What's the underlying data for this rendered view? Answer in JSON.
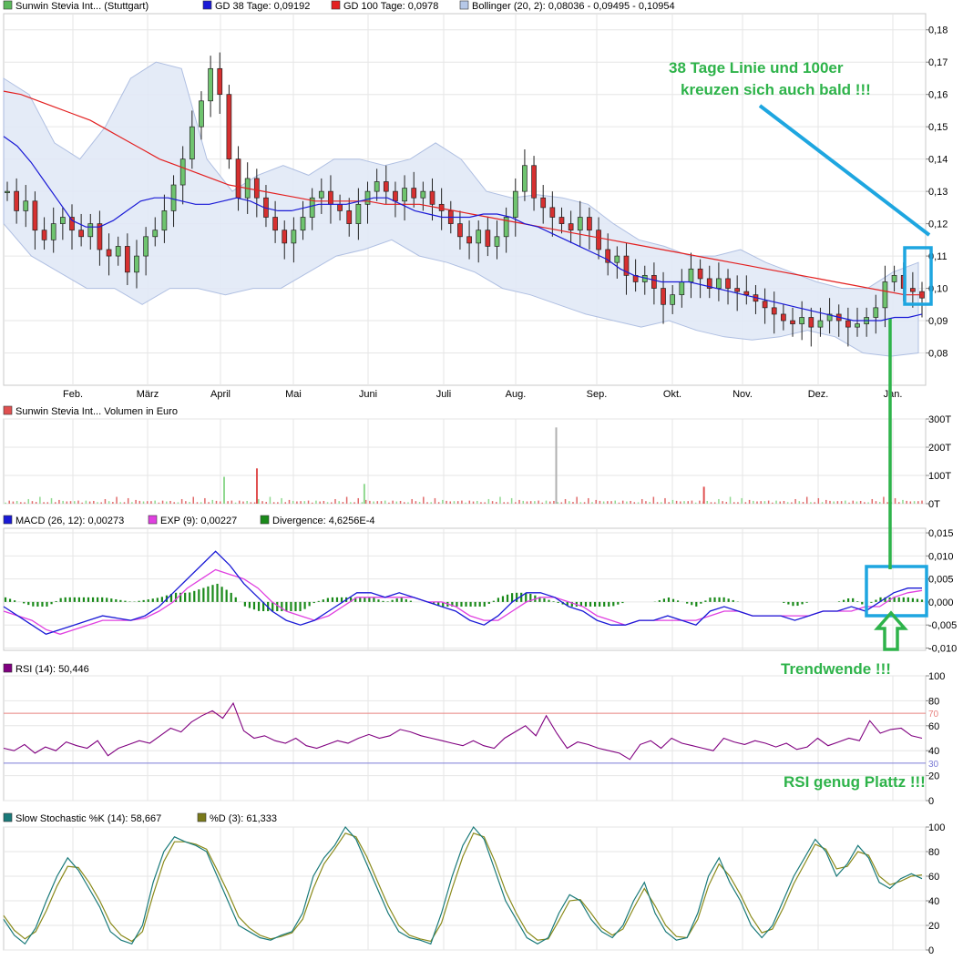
{
  "chart_data": [
    {
      "type": "candlestick",
      "panel": "price",
      "x_month_labels": [
        "Feb.",
        "März",
        "April",
        "Mai",
        "Juni",
        "Juli",
        "Aug.",
        "Sep.",
        "Okt.",
        "Nov.",
        "Dez.",
        "Jan."
      ],
      "ylim": [
        0.07,
        0.185
      ],
      "yticks": [
        "0,08",
        "0,09",
        "0,10",
        "0,11",
        "0,12",
        "0,13",
        "0,14",
        "0,15",
        "0,16",
        "0,17",
        "0,18"
      ],
      "ytick_values": [
        0.08,
        0.09,
        0.1,
        0.11,
        0.12,
        0.13,
        0.14,
        0.15,
        0.16,
        0.17,
        0.18
      ],
      "legend": [
        {
          "label": "Sunwin Stevia Int... (Stuttgart)",
          "color": "#5cb85c"
        },
        {
          "label": "GD 38 Tage: 0,09192",
          "color": "#1a1ad6"
        },
        {
          "label": "GD 100 Tage: 0,0978",
          "color": "#e32020"
        },
        {
          "label": "Bollinger (20, 2): 0,08036 - 0,09495 - 0,10954",
          "color": "#b6c8e8"
        }
      ],
      "close_path": [
        0.13,
        0.124,
        0.127,
        0.118,
        0.115,
        0.12,
        0.122,
        0.118,
        0.116,
        0.12,
        0.112,
        0.11,
        0.113,
        0.105,
        0.11,
        0.116,
        0.118,
        0.124,
        0.132,
        0.14,
        0.15,
        0.158,
        0.168,
        0.16,
        0.14,
        0.128,
        0.134,
        0.128,
        0.122,
        0.118,
        0.114,
        0.118,
        0.122,
        0.128,
        0.13,
        0.126,
        0.124,
        0.12,
        0.126,
        0.13,
        0.133,
        0.13,
        0.127,
        0.131,
        0.128,
        0.13,
        0.126,
        0.124,
        0.12,
        0.116,
        0.114,
        0.118,
        0.113,
        0.116,
        0.122,
        0.13,
        0.138,
        0.128,
        0.125,
        0.122,
        0.12,
        0.118,
        0.122,
        0.118,
        0.112,
        0.108,
        0.11,
        0.104,
        0.102,
        0.104,
        0.1,
        0.095,
        0.098,
        0.102,
        0.106,
        0.103,
        0.1,
        0.103,
        0.1,
        0.099,
        0.098,
        0.096,
        0.094,
        0.092,
        0.09,
        0.089,
        0.091,
        0.088,
        0.09,
        0.092,
        0.09,
        0.088,
        0.089,
        0.091,
        0.094,
        0.102,
        0.104,
        0.1,
        0.099,
        0.097
      ],
      "ma38_path": [
        0.147,
        0.144,
        0.139,
        0.133,
        0.127,
        0.121,
        0.119,
        0.119,
        0.121,
        0.124,
        0.127,
        0.128,
        0.128,
        0.127,
        0.126,
        0.126,
        0.127,
        0.128,
        0.127,
        0.125,
        0.124,
        0.124,
        0.125,
        0.126,
        0.126,
        0.126,
        0.127,
        0.128,
        0.128,
        0.126,
        0.124,
        0.123,
        0.122,
        0.122,
        0.122,
        0.123,
        0.123,
        0.122,
        0.12,
        0.119,
        0.117,
        0.115,
        0.113,
        0.111,
        0.109,
        0.106,
        0.104,
        0.103,
        0.102,
        0.102,
        0.102,
        0.101,
        0.1,
        0.099,
        0.098,
        0.097,
        0.096,
        0.095,
        0.094,
        0.093,
        0.092,
        0.091,
        0.09,
        0.09,
        0.09,
        0.091,
        0.091,
        0.092
      ],
      "ma100_path": [
        0.161,
        0.16,
        0.158,
        0.156,
        0.154,
        0.152,
        0.149,
        0.146,
        0.143,
        0.14,
        0.138,
        0.136,
        0.134,
        0.132,
        0.131,
        0.13,
        0.129,
        0.128,
        0.127,
        0.127,
        0.127,
        0.127,
        0.126,
        0.126,
        0.126,
        0.125,
        0.124,
        0.123,
        0.122,
        0.121,
        0.12,
        0.119,
        0.118,
        0.117,
        0.116,
        0.115,
        0.114,
        0.113,
        0.112,
        0.111,
        0.11,
        0.109,
        0.108,
        0.107,
        0.106,
        0.105,
        0.104,
        0.103,
        0.102,
        0.101,
        0.1,
        0.099,
        0.098,
        0.098
      ],
      "bollinger_upper": [
        0.165,
        0.16,
        0.145,
        0.14,
        0.15,
        0.165,
        0.17,
        0.168,
        0.14,
        0.13,
        0.135,
        0.138,
        0.135,
        0.14,
        0.14,
        0.138,
        0.14,
        0.145,
        0.14,
        0.13,
        0.128,
        0.129,
        0.128,
        0.126,
        0.12,
        0.115,
        0.113,
        0.11,
        0.11,
        0.112,
        0.108,
        0.105,
        0.102,
        0.1,
        0.1,
        0.105,
        0.108
      ],
      "bollinger_lower": [
        0.12,
        0.11,
        0.105,
        0.1,
        0.1,
        0.095,
        0.1,
        0.1,
        0.098,
        0.1,
        0.1,
        0.105,
        0.11,
        0.112,
        0.115,
        0.11,
        0.108,
        0.105,
        0.1,
        0.098,
        0.095,
        0.092,
        0.09,
        0.088,
        0.09,
        0.087,
        0.085,
        0.084,
        0.085,
        0.087,
        0.085,
        0.08,
        0.079,
        0.08
      ],
      "annotations": [
        "38 Tage Linie und 100er",
        "kreuzen sich auch bald !!!"
      ]
    },
    {
      "type": "bar",
      "panel": "volume",
      "legend": [
        {
          "label": "Sunwin Stevia Int... Volumen in Euro",
          "color": "#e05050"
        }
      ],
      "yticks": [
        "0T",
        "100T",
        "200T",
        "300T"
      ],
      "ytick_values": [
        0,
        100,
        200,
        300
      ],
      "ylim": [
        0,
        300
      ],
      "spikes": [
        {
          "month_pos": 2.05,
          "value": 95,
          "color": "#8fd88f"
        },
        {
          "month_pos": 2.5,
          "value": 125,
          "color": "#e05050"
        },
        {
          "month_pos": 3.95,
          "value": 70,
          "color": "#8fd88f"
        },
        {
          "month_pos": 6.5,
          "value": 270,
          "color": "#b0b0b0"
        },
        {
          "month_pos": 8.45,
          "value": 60,
          "color": "#e05050"
        }
      ],
      "baseline_values": [
        8,
        12,
        6,
        14,
        5,
        10,
        18,
        7,
        9,
        22,
        11,
        6,
        15,
        8,
        12,
        20,
        9,
        7,
        13,
        10
      ]
    },
    {
      "type": "line",
      "panel": "macd",
      "legend": [
        {
          "label": "MACD (26, 12): 0,00273",
          "color": "#1a1ad6"
        },
        {
          "label": "EXP (9): 0,00227",
          "color": "#e040e0"
        },
        {
          "label": "Divergence: 4,6256E-4",
          "color": "#1a8a1a"
        }
      ],
      "yticks": [
        "-0,010",
        "-0,005",
        "0,000",
        "0,005",
        "0,010",
        "0,015"
      ],
      "ytick_values": [
        -0.01,
        -0.005,
        0.0,
        0.005,
        0.01,
        0.015
      ],
      "ylim": [
        -0.0105,
        0.016
      ],
      "macd": [
        -0.001,
        -0.003,
        -0.005,
        -0.007,
        -0.006,
        -0.005,
        -0.004,
        -0.003,
        -0.0035,
        -0.004,
        -0.003,
        -0.001,
        0.002,
        0.005,
        0.008,
        0.011,
        0.008,
        0.004,
        0.001,
        -0.002,
        -0.004,
        -0.005,
        -0.004,
        -0.002,
        0.0,
        0.002,
        0.002,
        0.001,
        0.002,
        0.001,
        0.0,
        -0.001,
        -0.002,
        -0.004,
        -0.005,
        -0.003,
        0.0,
        0.002,
        0.002,
        0.001,
        -0.001,
        -0.002,
        -0.004,
        -0.005,
        -0.005,
        -0.004,
        -0.004,
        -0.003,
        -0.004,
        -0.005,
        -0.002,
        -0.001,
        -0.002,
        -0.003,
        -0.003,
        -0.003,
        -0.004,
        -0.003,
        -0.002,
        -0.002,
        -0.001,
        -0.002,
        0.0,
        0.002,
        0.003,
        0.003
      ],
      "exp": [
        -0.002,
        -0.003,
        -0.004,
        -0.006,
        -0.007,
        -0.006,
        -0.005,
        -0.004,
        -0.004,
        -0.004,
        -0.0035,
        -0.002,
        0.0,
        0.003,
        0.005,
        0.007,
        0.006,
        0.005,
        0.003,
        0.0,
        -0.002,
        -0.003,
        -0.004,
        -0.003,
        -0.001,
        0.001,
        0.001,
        0.001,
        0.001,
        0.001,
        0.0,
        0.0,
        -0.001,
        -0.003,
        -0.004,
        -0.004,
        -0.002,
        0.0,
        0.001,
        0.001,
        0.0,
        -0.001,
        -0.003,
        -0.004,
        -0.005,
        -0.004,
        -0.004,
        -0.004,
        -0.004,
        -0.004,
        -0.003,
        -0.002,
        -0.002,
        -0.003,
        -0.003,
        -0.003,
        -0.003,
        -0.003,
        -0.002,
        -0.002,
        -0.002,
        -0.001,
        -0.001,
        0.001,
        0.002,
        0.0025
      ],
      "annotation": "Trendwende !!!"
    },
    {
      "type": "line",
      "panel": "rsi",
      "legend": [
        {
          "label": "RSI (14): 50,446",
          "color": "#800080"
        }
      ],
      "yticks": [
        "0",
        "20",
        "40",
        "60",
        "80",
        "100"
      ],
      "ytick_values": [
        0,
        20,
        40,
        60,
        80,
        100
      ],
      "ylim": [
        0,
        100
      ],
      "reference_lines": [
        {
          "value": 70,
          "label": "70",
          "color": "#e8827f"
        },
        {
          "value": 30,
          "label": "30",
          "color": "#7b7bd6"
        }
      ],
      "values": [
        42,
        40,
        45,
        38,
        43,
        40,
        47,
        44,
        42,
        48,
        36,
        42,
        45,
        48,
        46,
        52,
        58,
        55,
        63,
        68,
        72,
        66,
        78,
        56,
        50,
        52,
        48,
        46,
        50,
        44,
        42,
        45,
        48,
        46,
        50,
        53,
        50,
        52,
        57,
        55,
        52,
        50,
        48,
        46,
        44,
        48,
        44,
        42,
        50,
        55,
        60,
        52,
        68,
        54,
        42,
        47,
        45,
        42,
        40,
        38,
        33,
        45,
        48,
        42,
        50,
        46,
        44,
        42,
        40,
        50,
        47,
        45,
        48,
        46,
        43,
        46,
        41,
        43,
        50,
        44,
        47,
        50,
        48,
        64,
        54,
        57,
        58,
        52,
        50
      ],
      "annotation": "RSI genug Plattz !!!"
    },
    {
      "type": "line",
      "panel": "stochastic",
      "legend": [
        {
          "label": "Slow Stochastic %K (14): 58,667",
          "color": "#1a7a7a"
        },
        {
          "label": "%D (3): 61,333",
          "color": "#7a7a1a"
        }
      ],
      "yticks": [
        "0",
        "20",
        "40",
        "60",
        "80",
        "100"
      ],
      "ytick_values": [
        0,
        20,
        40,
        60,
        80,
        100
      ],
      "ylim": [
        0,
        100
      ],
      "k": [
        25,
        12,
        5,
        18,
        40,
        60,
        75,
        65,
        50,
        35,
        15,
        8,
        5,
        20,
        55,
        80,
        92,
        88,
        85,
        80,
        60,
        40,
        20,
        15,
        10,
        8,
        12,
        15,
        30,
        60,
        75,
        85,
        100,
        90,
        70,
        50,
        30,
        15,
        10,
        8,
        5,
        30,
        60,
        85,
        100,
        90,
        65,
        40,
        25,
        10,
        5,
        10,
        30,
        45,
        40,
        25,
        15,
        10,
        20,
        40,
        55,
        30,
        15,
        8,
        10,
        30,
        60,
        75,
        55,
        40,
        20,
        10,
        20,
        40,
        60,
        75,
        90,
        80,
        60,
        70,
        85,
        75,
        55,
        50,
        58,
        62,
        58
      ],
      "d": [
        28,
        16,
        9,
        15,
        32,
        52,
        68,
        67,
        55,
        40,
        22,
        12,
        7,
        15,
        45,
        72,
        88,
        88,
        86,
        82,
        65,
        47,
        27,
        18,
        12,
        9,
        11,
        14,
        25,
        50,
        70,
        82,
        95,
        92,
        76,
        56,
        36,
        20,
        12,
        9,
        7,
        22,
        50,
        76,
        95,
        92,
        72,
        48,
        30,
        15,
        8,
        9,
        24,
        40,
        41,
        30,
        18,
        12,
        17,
        34,
        50,
        36,
        20,
        11,
        10,
        25,
        52,
        70,
        60,
        45,
        27,
        14,
        17,
        34,
        54,
        70,
        86,
        82,
        66,
        68,
        80,
        77,
        60,
        53,
        56,
        60,
        61
      ]
    }
  ]
}
